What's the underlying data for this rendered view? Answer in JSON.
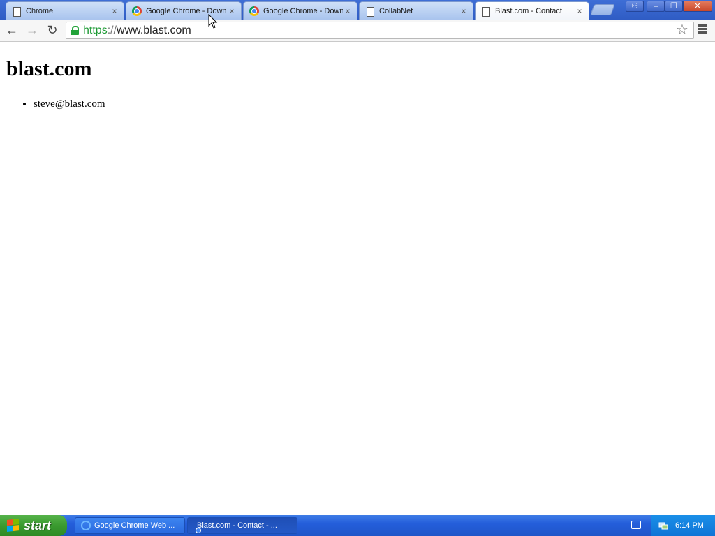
{
  "browser": {
    "tabs": [
      {
        "title": "Chrome",
        "icon": "document-icon",
        "active": false
      },
      {
        "title": "Google Chrome - Downl",
        "icon": "chrome-icon",
        "active": false
      },
      {
        "title": "Google Chrome - Downl",
        "icon": "chrome-icon",
        "active": false
      },
      {
        "title": "CollabNet",
        "icon": "document-icon",
        "active": false
      },
      {
        "title": "Blast.com - Contact",
        "icon": "document-icon",
        "active": true
      }
    ],
    "close_glyph": "×",
    "window_controls": {
      "user": "⚇",
      "minimize": "–",
      "restore": "❐",
      "close": "✕"
    },
    "nav": {
      "back": "←",
      "forward": "→",
      "reload": "↻"
    },
    "address": {
      "scheme": "https",
      "separator": "://",
      "host": "www.blast.com"
    },
    "star_glyph": "☆"
  },
  "page": {
    "heading": "blast.com",
    "contacts": [
      "steve@blast.com"
    ]
  },
  "taskbar": {
    "start_label": "start",
    "buttons": [
      {
        "label": "Google Chrome Web ...",
        "icon": "ie-icon",
        "active": false
      },
      {
        "label": "Blast.com - Contact - ...",
        "icon": "chrome-icon",
        "active": true
      }
    ],
    "clock": "6:14 PM"
  },
  "colors": {
    "secure_green": "#1e9a35",
    "taskbar_blue": "#245edb",
    "start_green": "#3a9a2f"
  }
}
